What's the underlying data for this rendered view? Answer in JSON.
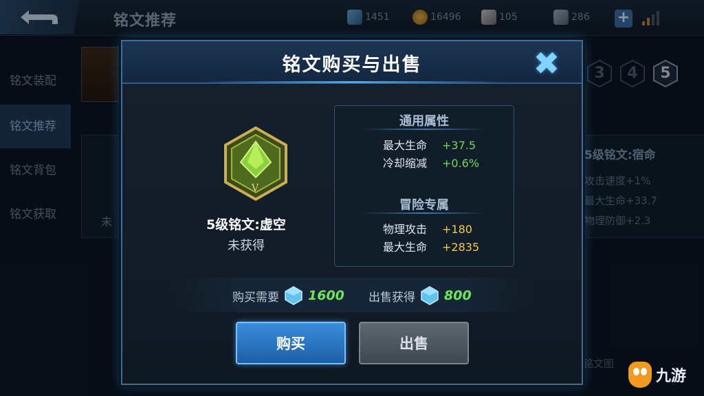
{
  "background": {
    "title": "铭文推荐",
    "resources": [
      {
        "icon": "diamond-icon",
        "value": "1451"
      },
      {
        "icon": "gold-coin-icon",
        "value": "16496"
      },
      {
        "icon": "gem-icon",
        "value": "105"
      },
      {
        "icon": "ticket-icon",
        "value": "286"
      }
    ],
    "sidebar": [
      {
        "label": "铭文装配"
      },
      {
        "label": "铭文推荐"
      },
      {
        "label": "铭文背包"
      },
      {
        "label": "铭文获取"
      }
    ],
    "left_card_text": "未",
    "level_tabs": [
      "3",
      "4",
      "5"
    ],
    "right_panel": {
      "title": "5级铭文:宿命",
      "lines": [
        "攻击速度+1%",
        "最大生命+33.7",
        "物理防御+2.3"
      ]
    },
    "bottom_text": "铭文图",
    "watermark": "九游"
  },
  "modal": {
    "title": "铭文购买与出售",
    "close_icon": "close-x-icon",
    "rune": {
      "name": "5级铭文:虚空",
      "status": "未获得"
    },
    "general_attrs": {
      "title": "通用属性",
      "rows": [
        {
          "label": "最大生命",
          "value": "+37.5"
        },
        {
          "label": "冷却缩减",
          "value": "+0.6%"
        }
      ]
    },
    "adventure_attrs": {
      "title": "冒险专属",
      "rows": [
        {
          "label": "物理攻击",
          "value": "+180"
        },
        {
          "label": "最大生命",
          "value": "+2835"
        }
      ]
    },
    "buy_price": {
      "label": "购买需要",
      "value": "1600"
    },
    "sell_price": {
      "label": "出售获得",
      "value": "800"
    },
    "buy_button": "购买",
    "sell_button": "出售"
  },
  "colors": {
    "accent_blue": "#3a8edc",
    "green_value": "#6ed85a",
    "gold_value": "#f2c94a"
  }
}
